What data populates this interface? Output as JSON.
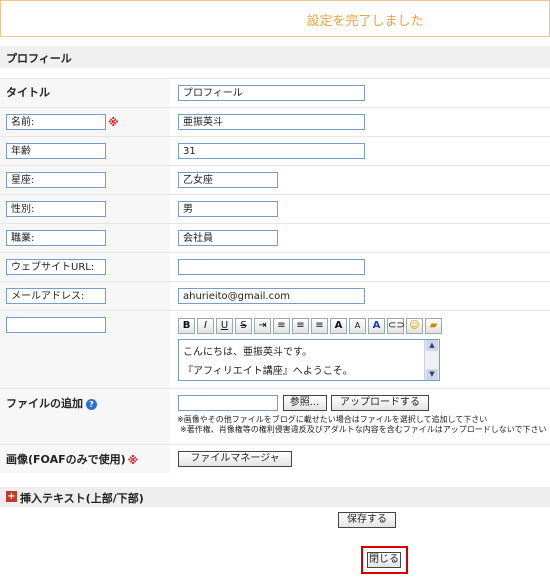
{
  "banner": {
    "message": "設定を完了しました"
  },
  "section": {
    "title": "プロフィール"
  },
  "rows": {
    "title": {
      "label": "タイトル",
      "value": "プロフィール"
    },
    "name": {
      "label_value": "名前:",
      "value": "亜振英斗",
      "required": "※"
    },
    "age": {
      "label_value": "年齢",
      "value": "31"
    },
    "sign": {
      "label_value": "星座:",
      "value": "乙女座"
    },
    "sex": {
      "label_value": "性別:",
      "value": "男"
    },
    "job": {
      "label_value": "職業:",
      "value": "会社員"
    },
    "website": {
      "label_value": "ウェブサイトURL:",
      "value": ""
    },
    "email": {
      "label_value": "メールアドレス:",
      "value": "ahurieito@gmail.com"
    },
    "custom": {
      "label_value": ""
    }
  },
  "editor": {
    "toolbar": {
      "bold": "B",
      "italic": "I",
      "underline": "U",
      "strike": "S",
      "font_up": "A",
      "font_down": "A",
      "color": "A"
    },
    "lines": [
      "こんにちは、亜振英斗です。",
      "『アフィリエイト講座』へようこそ。"
    ]
  },
  "file_add": {
    "label": "ファイルの追加",
    "browse": "参照...",
    "upload": "アップロードする",
    "note1": "※画像やその他ファイルをブログに載せたい場合はファイルを選択して追加して下さい",
    "note2": "※著作権、肖像権等の権利侵害違反及びアダルトな内容を含むファイルはアップロードしないで下さい"
  },
  "image": {
    "label": "画像(FOAFのみで使用)",
    "required": "※",
    "file_manager": "ファイルマネージャ"
  },
  "insert": {
    "title": "挿入テキスト(上部/下部)"
  },
  "actions": {
    "save": "保存する",
    "close": "閉じる"
  },
  "colors": {
    "banner_border": "#f1c58b",
    "banner_text": "#f0a040",
    "required": "#e02020",
    "close_outline": "#d40000"
  }
}
